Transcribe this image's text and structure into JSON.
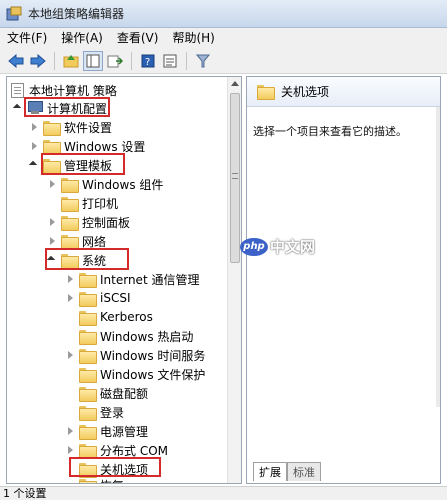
{
  "window": {
    "title": "本地组策略编辑器"
  },
  "menu": [
    "文件(F)",
    "操作(A)",
    "查看(V)",
    "帮助(H)"
  ],
  "toolbar": {
    "icons": [
      "back-arrow-icon",
      "forward-arrow-icon",
      "up-folder-icon",
      "show-hide-tree-icon",
      "export-list-icon",
      "help-icon",
      "properties-icon",
      "filter-icon"
    ]
  },
  "tree": {
    "root": "本地计算机 策略",
    "computer_config": "计算机配置",
    "software_settings": "软件设置",
    "windows_settings": "Windows 设置",
    "admin_templates": "管理模板",
    "windows_components": "Windows 组件",
    "printers": "打印机",
    "control_panel": "控制面板",
    "network": "网络",
    "system": "系统",
    "internet_comm": "Internet 通信管理",
    "iscsi": "iSCSI",
    "kerberos": "Kerberos",
    "win_hotstart": "Windows 热启动",
    "win_time": "Windows 时间服务",
    "win_file_protection": "Windows 文件保护",
    "disk_quota": "磁盘配额",
    "logon": "登录",
    "power_mgmt": "电源管理",
    "distributed_com": "分布式 COM",
    "shutdown_options": "关机选项",
    "recovery": "恢复"
  },
  "detail": {
    "title": "关机选项",
    "description": "选择一个项目来查看它的描述。",
    "tabs": [
      "扩展",
      "标准"
    ]
  },
  "status": {
    "text": "1 个设置"
  },
  "watermark": {
    "logo": "php",
    "text": "中文网"
  },
  "colors": {
    "highlight": "#d52a2a",
    "folder": "#f2cb5d"
  }
}
